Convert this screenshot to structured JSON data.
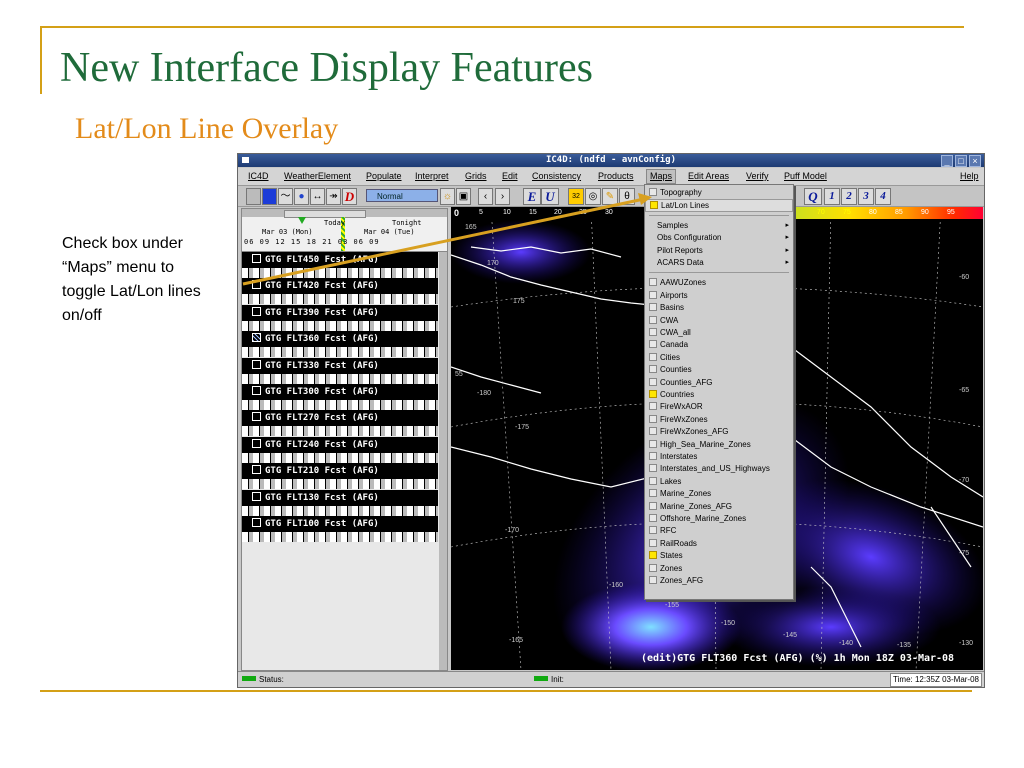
{
  "slide": {
    "title": "New Interface Display Features",
    "subtitle": "Lat/Lon Line Overlay",
    "callout": [
      "Check box under",
      "“Maps” menu to",
      "toggle Lat/Lon lines",
      "on/off"
    ]
  },
  "window": {
    "title": "IC4D: (ndfd - avnConfig)",
    "menus": [
      "IC4D",
      "WeatherElement",
      "Populate",
      "Interpret",
      "Grids",
      "Edit",
      "Consistency",
      "Products",
      "Maps",
      "Edit Areas",
      "Verify",
      "Puff Model",
      "Help"
    ]
  },
  "toolbar": {
    "mode": "Normal",
    "tools": [
      "D",
      "E",
      "U",
      "Q",
      "1",
      "2",
      "3",
      "4"
    ]
  },
  "timeline": {
    "today": "Today",
    "tonight": "Tonight",
    "date1": "Mar 03 (Mon)",
    "date2": "Mar 04 (Tue)",
    "hours": "06 09 12 15 18 21 03 06 09"
  },
  "grids": [
    {
      "label": "GTG FLT450 Fcst (AFG)",
      "selected": false
    },
    {
      "label": "GTG FLT420 Fcst (AFG)",
      "selected": false
    },
    {
      "label": "GTG FLT390 Fcst (AFG)",
      "selected": false
    },
    {
      "label": "GTG FLT360 Fcst (AFG)",
      "selected": true
    },
    {
      "label": "GTG FLT330 Fcst (AFG)",
      "selected": false
    },
    {
      "label": "GTG FLT300 Fcst (AFG)",
      "selected": false
    },
    {
      "label": "GTG FLT270 Fcst (AFG)",
      "selected": false
    },
    {
      "label": "GTG FLT240 Fcst (AFG)",
      "selected": false
    },
    {
      "label": "GTG FLT210 Fcst (AFG)",
      "selected": false
    },
    {
      "label": "GTG FLT130 Fcst (AFG)",
      "selected": false
    },
    {
      "label": "GTG FLT100 Fcst (AFG)",
      "selected": false
    }
  ],
  "colorbar": {
    "left_ticks": [
      "0",
      "5",
      "10",
      "15",
      "20",
      "25",
      "30"
    ],
    "right_ticks": [
      "70",
      "75",
      "80",
      "85",
      "90",
      "95"
    ]
  },
  "map": {
    "lon_labels": [
      "165",
      "170",
      "175",
      "-180",
      "-175",
      "-170",
      "-165",
      "-160",
      "-155",
      "-150",
      "-145",
      "-140",
      "-135",
      "-130",
      "-60",
      "-65",
      "-70",
      "-75",
      "55"
    ],
    "footer": "(edit)GTG FLT360 Fcst (AFG) (%)   1h Mon 18Z 03-Mar-08"
  },
  "maps_menu": {
    "top_items": [
      {
        "label": "Topography",
        "checked": false
      },
      {
        "label": "Lat/Lon Lines",
        "checked": true
      }
    ],
    "submenus": [
      "Samples",
      "Obs Configuration",
      "Pilot Reports",
      "ACARS Data"
    ],
    "overlays": [
      {
        "label": "AAWUZones",
        "checked": false
      },
      {
        "label": "Airports",
        "checked": false
      },
      {
        "label": "Basins",
        "checked": false
      },
      {
        "label": "CWA",
        "checked": false
      },
      {
        "label": "CWA_all",
        "checked": false
      },
      {
        "label": "Canada",
        "checked": false
      },
      {
        "label": "Cities",
        "checked": false
      },
      {
        "label": "Counties",
        "checked": false
      },
      {
        "label": "Counties_AFG",
        "checked": false
      },
      {
        "label": "Countries",
        "checked": true
      },
      {
        "label": "FireWxAOR",
        "checked": false
      },
      {
        "label": "FireWxZones",
        "checked": false
      },
      {
        "label": "FireWxZones_AFG",
        "checked": false
      },
      {
        "label": "High_Sea_Marine_Zones",
        "checked": false
      },
      {
        "label": "Interstates",
        "checked": false
      },
      {
        "label": "Interstates_and_US_Highways",
        "checked": false
      },
      {
        "label": "Lakes",
        "checked": false
      },
      {
        "label": "Marine_Zones",
        "checked": false
      },
      {
        "label": "Marine_Zones_AFG",
        "checked": false
      },
      {
        "label": "Offshore_Marine_Zones",
        "checked": false
      },
      {
        "label": "RFC",
        "checked": false
      },
      {
        "label": "RailRoads",
        "checked": false
      },
      {
        "label": "States",
        "checked": true
      },
      {
        "label": "Zones",
        "checked": false
      },
      {
        "label": "Zones_AFG",
        "checked": false
      }
    ]
  },
  "status": {
    "status_label": "Status:",
    "init_label": "Init:",
    "time": "Time: 12:35Z 03-Mar-08"
  },
  "colors": {
    "title_green": "#1f6b3a",
    "subtitle_orange": "#e38b1a",
    "rule_gold": "#d4a017",
    "arrow": "#d8a020"
  }
}
